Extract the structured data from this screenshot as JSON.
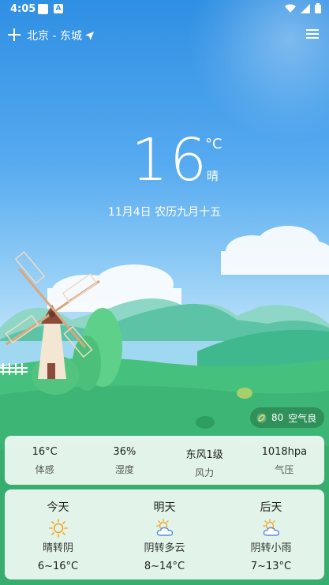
{
  "status_bar": {
    "time": "4:05",
    "notif_letter": "A"
  },
  "header": {
    "location": "北京 - 东城"
  },
  "current": {
    "temperature": "16",
    "unit": "°C",
    "condition": "晴",
    "date": "11月4日 农历九月十五"
  },
  "air_quality": {
    "value": "80",
    "label": "空气良"
  },
  "details": [
    {
      "value": "16°C",
      "label": "体感"
    },
    {
      "value": "36%",
      "label": "湿度"
    },
    {
      "value": "东风1级",
      "label": "风力"
    },
    {
      "value": "1018hpa",
      "label": "气压"
    }
  ],
  "forecast": [
    {
      "day": "今天",
      "icon": "sun-icon",
      "condition": "晴转阴",
      "range": "6~16°C"
    },
    {
      "day": "明天",
      "icon": "partly-cloudy-icon",
      "condition": "阴转多云",
      "range": "8~14°C"
    },
    {
      "day": "后天",
      "icon": "partly-cloudy-icon",
      "condition": "阴转小雨",
      "range": "7~13°C"
    }
  ],
  "colors": {
    "sky_top": "#2f8fe3",
    "sun_orange": "#f5a623",
    "cloud_blue": "#6fa8e8",
    "grass": "#3fbf7a"
  }
}
